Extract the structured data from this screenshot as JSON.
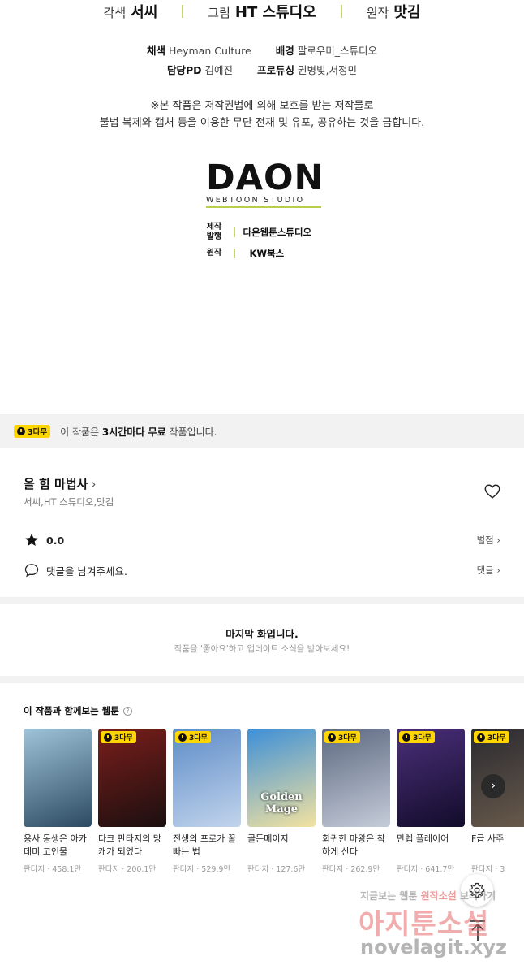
{
  "credits": {
    "adapt_role": "각색",
    "adapt_name": "서씨",
    "art_role": "그림",
    "art_name": "HT 스튜디오",
    "orig_role": "원작",
    "orig_name": "맛김"
  },
  "staff": {
    "color_label": "채색",
    "color_value": "Heyman Culture",
    "bg_label": "배경",
    "bg_value": "팔로우미_스튜디오",
    "pd_label": "담당PD",
    "pd_value": "김예진",
    "producing_label": "프로듀싱",
    "producing_value": "권병빛,서정민"
  },
  "notice": {
    "line1": "※본 작품은 저작권법에 의해 보호를 받는 저작물로",
    "line2": "불법 복제와 캡처 등을 이용한 무단 전재 및 유포, 공유하는 것을 금합니다."
  },
  "logo": {
    "main": "DAON",
    "sub": "WEBTOON STUDIO"
  },
  "production": {
    "make_label_1": "제작",
    "make_label_2": "발행",
    "make_value": "다온웹툰스튜디오",
    "orig_label": "원작",
    "orig_value": "KW북스"
  },
  "free_banner": {
    "badge": "3다무",
    "text_prefix": "이 작품은 ",
    "text_bold": "3시간마다 무료",
    "text_suffix": " 작품입니다."
  },
  "work": {
    "title": "올 힘 마법사",
    "chevron": "›",
    "authors": "서씨,HT 스튜디오,맛김",
    "rating": "0.0",
    "rate_link": "별점 ›",
    "comment_prompt": "댓글을 남겨주세요.",
    "comment_link": "댓글 ›"
  },
  "last_episode": {
    "title": "마지막 화입니다.",
    "subtitle": "작품을 '좋아요'하고 업데이트 소식을 받아보세요!"
  },
  "recommendations": {
    "heading": "이 작품과 함께보는 웹툰",
    "help": "?",
    "next": "›",
    "items": [
      {
        "title": "용사 동생은 아카데미 고인물",
        "meta": "판타지 · 458.1만",
        "badge": "",
        "cover": "",
        "c1": "#9fc3d8",
        "c2": "#2c4b63"
      },
      {
        "title": "다크 판타지의 망캐가 되었다",
        "meta": "판타지 · 200.1만",
        "badge": "3다무",
        "cover": "",
        "c1": "#7a1e1a",
        "c2": "#1b0f10"
      },
      {
        "title": "전생의 프로가 꿀빠는 법",
        "meta": "판타지 · 529.9만",
        "badge": "3다무",
        "cover": "",
        "c1": "#5d8cc7",
        "c2": "#c2d4ec"
      },
      {
        "title": "골든메이지",
        "meta": "판타지 · 127.6만",
        "badge": "",
        "cover": "Golden Mage",
        "c1": "#3d8fd8",
        "c2": "#f2e2a0"
      },
      {
        "title": "회귀한 마왕은 착하게 산다",
        "meta": "판타지 · 262.9만",
        "badge": "3다무",
        "cover": "",
        "c1": "#5c6880",
        "c2": "#c5ccd9"
      },
      {
        "title": "만렙 플레이어",
        "meta": "판타지 · 641.7만",
        "badge": "3다무",
        "cover": "",
        "c1": "#4b2f7a",
        "c2": "#120c2a"
      },
      {
        "title": "F급 사주",
        "meta": "판타지 · 3",
        "badge": "3다무",
        "cover": "",
        "c1": "#2a2a30",
        "c2": "#6a5b4c"
      }
    ]
  },
  "watermark": {
    "line1_a": "지금보는 웹툰 ",
    "line1_b": "원작소설",
    "line1_c": " 보러가기",
    "line2": "아지툰소설",
    "line3": "novelagit.xyz"
  }
}
